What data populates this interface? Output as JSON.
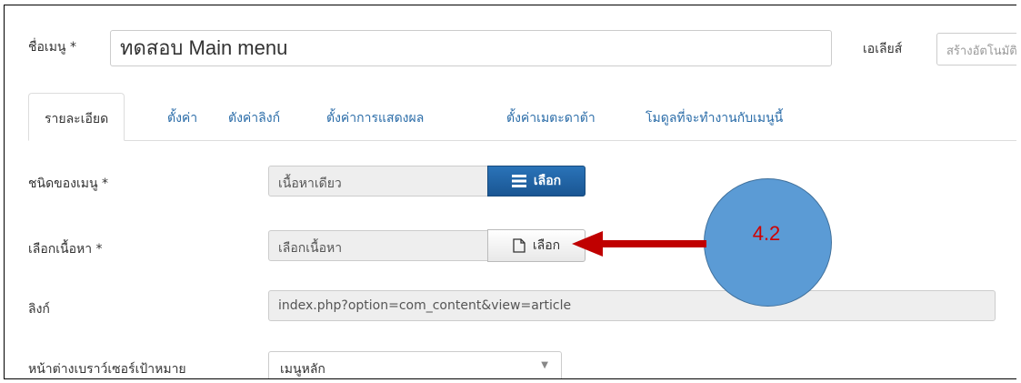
{
  "form": {
    "title_label": "ชื่อเมนู *",
    "title_value": "ทดสอบ Main menu",
    "alias_label": "เอเลียส์",
    "alias_placeholder": "สร้างอัตโนมัติ"
  },
  "tabs": [
    {
      "label": "รายละเอียด",
      "active": true
    },
    {
      "label": "ตั้งค่า"
    },
    {
      "label": "ตังค่าลิงก์"
    },
    {
      "label": "ตั้งค่าการแสดงผล"
    },
    {
      "label": "ตั้งค่าเมตะดาต้า"
    },
    {
      "label": "โมดูลที่จะทำงานกับเมนูนี้"
    }
  ],
  "fields": {
    "menu_type": {
      "label": "ชนิดของเมนู *",
      "value": "เนื้อหาเดียว",
      "button": "เลือก"
    },
    "select_content": {
      "label": "เลือกเนื้อหา *",
      "value": "เลือกเนื้อหา",
      "button": "เลือก"
    },
    "link": {
      "label": "ลิงก์",
      "value": "index.php?option=com_content&view=article"
    },
    "target_window": {
      "label": "หน้าต่างเบราว์เซอร์เป้าหมาย",
      "value": "เมนูหลัก"
    }
  },
  "annotation": {
    "label": "4.2",
    "circle_color": "#5b9bd5",
    "arrow_color": "#c00000"
  },
  "colors": {
    "primary_button": "#1f5f9e",
    "tab_link": "#2a6ca8"
  },
  "icons": {
    "menu_type_button": "list-icon",
    "select_content_button": "document-icon",
    "select_caret": "caret-down-icon"
  }
}
